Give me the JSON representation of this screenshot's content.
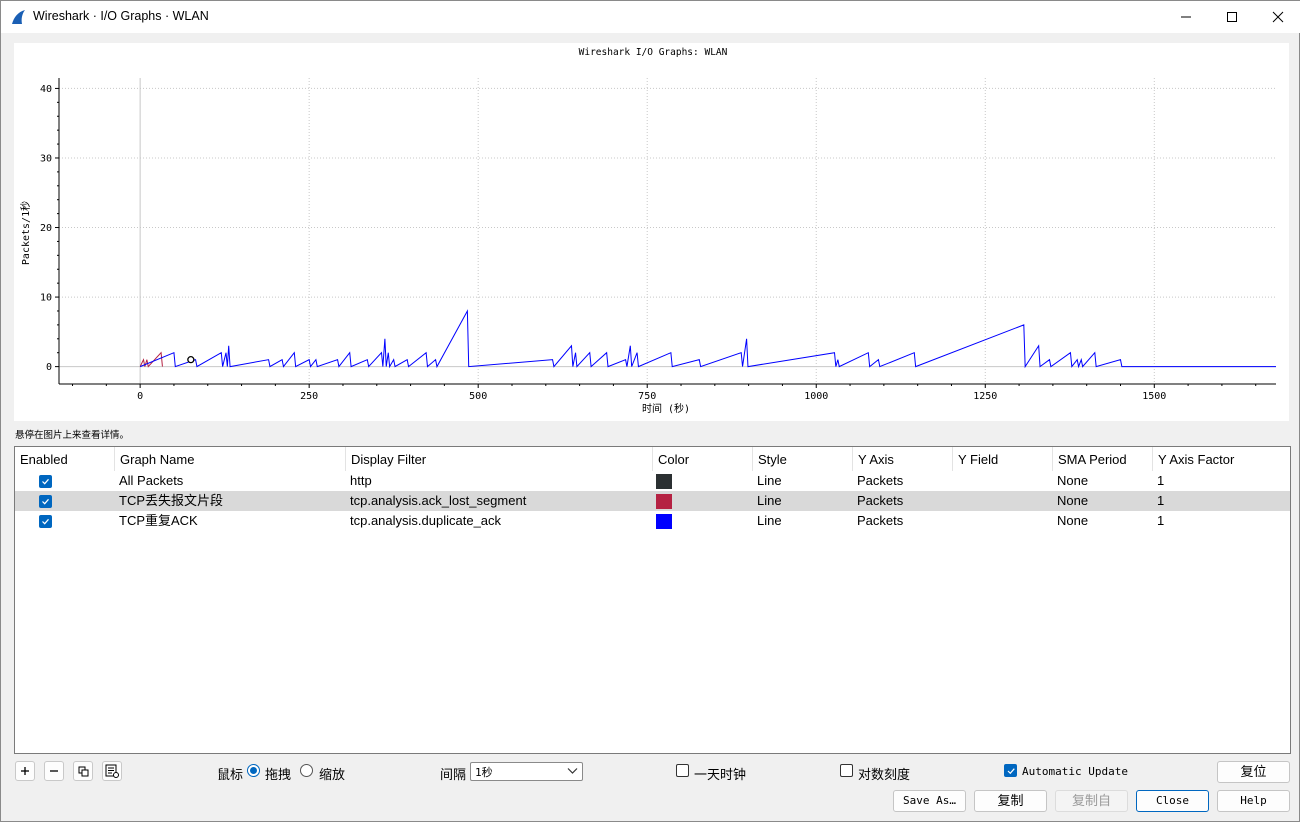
{
  "window": {
    "title": "Wireshark · I/O Graphs · WLAN",
    "minimize_icon": "minimize-icon",
    "maximize_icon": "maximize-icon",
    "close_icon": "close-icon"
  },
  "chart_data": {
    "type": "line",
    "title": "Wireshark I/O Graphs: WLAN",
    "xlabel": "时间 (秒)",
    "ylabel": "Packets/1秒",
    "xlim": [
      -120,
      1680
    ],
    "ylim": [
      -2.5,
      41.5
    ],
    "x_ticks": [
      0,
      250,
      500,
      750,
      1000,
      1250,
      1500
    ],
    "y_ticks": [
      0,
      10,
      20,
      30,
      40
    ],
    "grid": true,
    "series": [
      {
        "name": "TCP丢失报文片段",
        "color": "#b52243",
        "points": [
          [
            0,
            0
          ],
          [
            5,
            1
          ],
          [
            7,
            0
          ],
          [
            10,
            1
          ],
          [
            12,
            0
          ],
          [
            31,
            2
          ],
          [
            33,
            0
          ]
        ]
      },
      {
        "name": "TCP重复ACK",
        "color": "#0000ff",
        "points": [
          [
            0,
            0
          ],
          [
            50,
            2
          ],
          [
            52,
            0
          ],
          [
            82,
            1
          ],
          [
            84,
            0
          ],
          [
            120,
            2
          ],
          [
            122,
            0
          ],
          [
            127,
            2
          ],
          [
            129,
            0
          ],
          [
            131,
            3
          ],
          [
            133,
            0
          ],
          [
            190,
            1
          ],
          [
            192,
            0
          ],
          [
            210,
            1
          ],
          [
            212,
            0
          ],
          [
            228,
            2
          ],
          [
            230,
            0
          ],
          [
            250,
            1
          ],
          [
            252,
            0
          ],
          [
            260,
            1
          ],
          [
            262,
            0
          ],
          [
            292,
            1
          ],
          [
            294,
            0
          ],
          [
            310,
            2
          ],
          [
            312,
            0
          ],
          [
            336,
            1
          ],
          [
            338,
            0
          ],
          [
            357,
            2
          ],
          [
            359,
            0
          ],
          [
            362,
            4
          ],
          [
            364,
            0
          ],
          [
            367,
            2
          ],
          [
            369,
            0
          ],
          [
            375,
            1
          ],
          [
            377,
            0
          ],
          [
            395,
            1
          ],
          [
            397,
            0
          ],
          [
            423,
            2
          ],
          [
            425,
            0
          ],
          [
            437,
            1
          ],
          [
            439,
            0
          ],
          [
            484,
            8
          ],
          [
            486,
            0
          ],
          [
            610,
            1
          ],
          [
            612,
            0
          ],
          [
            638,
            3
          ],
          [
            640,
            0
          ],
          [
            644,
            2
          ],
          [
            646,
            0
          ],
          [
            665,
            2
          ],
          [
            667,
            0
          ],
          [
            690,
            2
          ],
          [
            692,
            0
          ],
          [
            718,
            1
          ],
          [
            720,
            0
          ],
          [
            725,
            3
          ],
          [
            727,
            0
          ],
          [
            735,
            2
          ],
          [
            737,
            0
          ],
          [
            785,
            2
          ],
          [
            787,
            0
          ],
          [
            827,
            1
          ],
          [
            829,
            0
          ],
          [
            889,
            2
          ],
          [
            891,
            0
          ],
          [
            897,
            4
          ],
          [
            899,
            0
          ],
          [
            1027,
            2
          ],
          [
            1029,
            0
          ],
          [
            1032,
            1
          ],
          [
            1034,
            0
          ],
          [
            1077,
            2
          ],
          [
            1079,
            0
          ],
          [
            1092,
            1
          ],
          [
            1094,
            0
          ],
          [
            1145,
            2
          ],
          [
            1147,
            0
          ],
          [
            1307,
            6
          ],
          [
            1309,
            0
          ],
          [
            1329,
            3
          ],
          [
            1331,
            0
          ],
          [
            1345,
            1
          ],
          [
            1347,
            0
          ],
          [
            1376,
            2
          ],
          [
            1378,
            0
          ],
          [
            1386,
            1
          ],
          [
            1388,
            0
          ],
          [
            1392,
            1
          ],
          [
            1394,
            0
          ],
          [
            1412,
            2
          ],
          [
            1414,
            0
          ],
          [
            1450,
            1
          ],
          [
            1452,
            0
          ],
          [
            1680,
            0
          ]
        ]
      }
    ],
    "annotations": [
      {
        "type": "marker",
        "shape": "circle",
        "x": 75,
        "y": 1
      }
    ]
  },
  "hint": "悬停在图片上来查看详情。",
  "table": {
    "columns": [
      "Enabled",
      "Graph Name",
      "Display Filter",
      "Color",
      "Style",
      "Y Axis",
      "Y Field",
      "SMA Period",
      "Y Axis Factor"
    ],
    "rows": [
      {
        "enabled": true,
        "name": "All Packets",
        "filter": "http",
        "color": "#2b3032",
        "style": "Line",
        "y_axis": "Packets",
        "y_field": "",
        "sma": "None",
        "factor": "1"
      },
      {
        "enabled": true,
        "name": "TCP丢失报文片段",
        "filter": "tcp.analysis.ack_lost_segment",
        "color": "#b52243",
        "style": "Line",
        "y_axis": "Packets",
        "y_field": "",
        "sma": "None",
        "factor": "1"
      },
      {
        "enabled": true,
        "name": "TCP重复ACK",
        "filter": "tcp.analysis.duplicate_ack",
        "color": "#0000ff",
        "style": "Line",
        "y_axis": "Packets",
        "y_field": "",
        "sma": "None",
        "factor": "1"
      }
    ]
  },
  "controls": {
    "add_icon": "plus-icon",
    "remove_icon": "minus-icon",
    "copy_icon": "copy-icon",
    "clear_icon": "clear-icon",
    "mouse_label": "鼠标",
    "drag_label": "拖拽",
    "zoom_label": "缩放",
    "interval_label": "间隔",
    "interval_value": "1秒",
    "time_of_day_label": "一天时钟",
    "log_scale_label": "对数刻度",
    "auto_update_label": "Automatic Update",
    "reset_label": "复位",
    "save_as_label": "Save As…",
    "copy_label": "复制",
    "copy_from_label": "复制自",
    "close_label": "Close",
    "help_label": "Help"
  }
}
